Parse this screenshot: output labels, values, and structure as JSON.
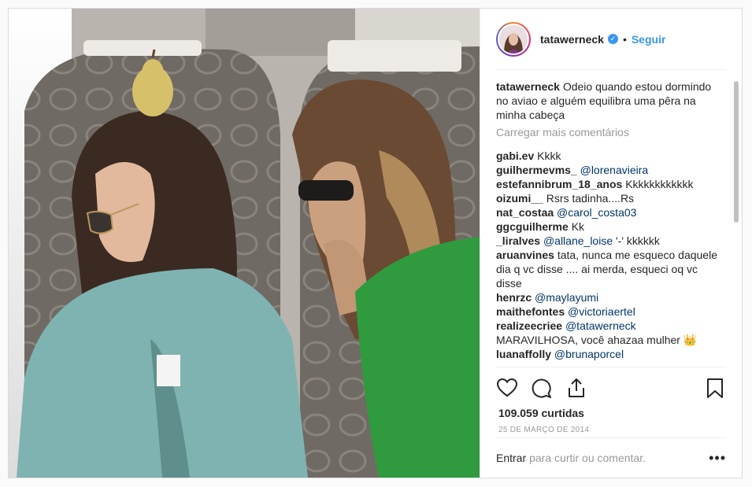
{
  "header": {
    "username": "tatawerneck",
    "verified_glyph": "✓",
    "separator": "•",
    "follow_label": "Seguir"
  },
  "caption": {
    "username": "tatawerneck",
    "text": "Odeio quando estou dormindo no aviao e alguém equilibra uma pêra na minha cabeça"
  },
  "load_more": "Carregar mais comentários",
  "comments": [
    {
      "user": "gabi.ev",
      "mention": "",
      "text": "Kkkk"
    },
    {
      "user": "guilhermevms_",
      "mention": "@lorenavieira",
      "text": ""
    },
    {
      "user": "estefannibrum_18_anos",
      "mention": "",
      "text": "Kkkkkkkkkkkk"
    },
    {
      "user": "oizumi__",
      "mention": "",
      "text": "Rsrs tadinha....Rs"
    },
    {
      "user": "nat_costaa",
      "mention": "@carol_costa03",
      "text": ""
    },
    {
      "user": "ggcguilherme",
      "mention": "",
      "text": "Kk"
    },
    {
      "user": "_liralves",
      "mention": "@allane_loise",
      "text": "'-' kkkkkk"
    },
    {
      "user": "aruanvines",
      "mention": "",
      "text": "tata, nunca me esqueco daquele dia q vc disse .... ai merda, esqueci oq vc disse"
    },
    {
      "user": "henrzc",
      "mention": "@maylayumi",
      "text": ""
    },
    {
      "user": "maithefontes",
      "mention": "@victoriaertel",
      "text": ""
    },
    {
      "user": "realizeecriee",
      "mention": "@tatawerneck",
      "text": ""
    },
    {
      "user": "",
      "mention": "",
      "text": "MARAVILHOSA, você ahazaa mulher 👑"
    },
    {
      "user": "luanaffolly",
      "mention": "@brunaporcel",
      "text": ""
    }
  ],
  "icons": {
    "like": "heart-icon",
    "comment": "comment-icon",
    "share": "share-icon",
    "save": "bookmark-icon",
    "more": "more-options-icon"
  },
  "likes": "109.059 curtidas",
  "date": "25 DE MARÇO DE 2014",
  "login": {
    "link": "Entrar",
    "text": "para curtir ou comentar."
  },
  "more_glyph": "•••",
  "colors": {
    "accent": "#3897f0",
    "mention": "#003569",
    "muted": "#999999",
    "border": "#dbdbdb"
  }
}
